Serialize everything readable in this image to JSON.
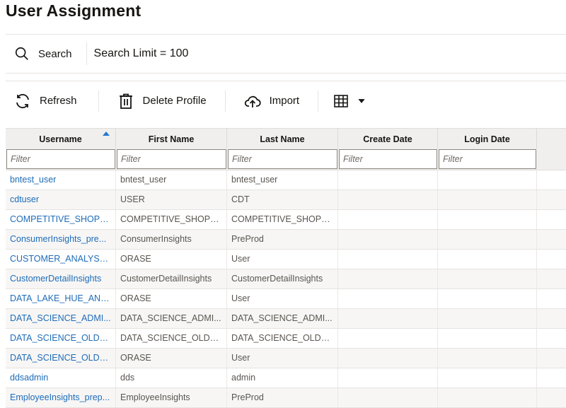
{
  "page": {
    "title": "User Assignment"
  },
  "search": {
    "button_label": "Search",
    "limit_text": "Search Limit = 100"
  },
  "toolbar": {
    "refresh_label": "Refresh",
    "delete_label": "Delete Profile",
    "import_label": "Import"
  },
  "table": {
    "columns": [
      "Username",
      "First Name",
      "Last Name",
      "Create Date",
      "Login Date"
    ],
    "sorted_column": "Username",
    "sort_direction": "ascending",
    "filter_placeholder": "Filter",
    "rows": [
      [
        "bntest_user",
        "bntest_user",
        "bntest_user",
        "",
        ""
      ],
      [
        "cdtuser",
        "USER",
        "CDT",
        "",
        ""
      ],
      [
        "COMPETITIVE_SHOPP...",
        "COMPETITIVE_SHOPP...",
        "COMPETITIVE_SHOPP...",
        "",
        ""
      ],
      [
        "ConsumerInsights_pre...",
        "ConsumerInsights",
        "PreProd",
        "",
        ""
      ],
      [
        "CUSTOMER_ANALYST...",
        "ORASE",
        "User",
        "",
        ""
      ],
      [
        "CustomerDetailInsights",
        "CustomerDetailInsights",
        "CustomerDetailInsights",
        "",
        ""
      ],
      [
        "DATA_LAKE_HUE_ANA...",
        "ORASE",
        "User",
        "",
        ""
      ],
      [
        "DATA_SCIENCE_ADMI...",
        "DATA_SCIENCE_ADMI...",
        "DATA_SCIENCE_ADMI...",
        "",
        ""
      ],
      [
        "DATA_SCIENCE_OLDS_...",
        "DATA_SCIENCE_OLDS_...",
        "DATA_SCIENCE_OLDS_...",
        "",
        ""
      ],
      [
        "DATA_SCIENCE_OLDS_...",
        "ORASE",
        "User",
        "",
        ""
      ],
      [
        "ddsadmin",
        "dds",
        "admin",
        "",
        ""
      ],
      [
        "EmployeeInsights_prep...",
        "EmployeeInsights",
        "PreProd",
        "",
        ""
      ]
    ]
  },
  "colors": {
    "link": "#1e6cb8",
    "sort_indicator": "#227ad0",
    "header_bg": "#f1efed"
  }
}
